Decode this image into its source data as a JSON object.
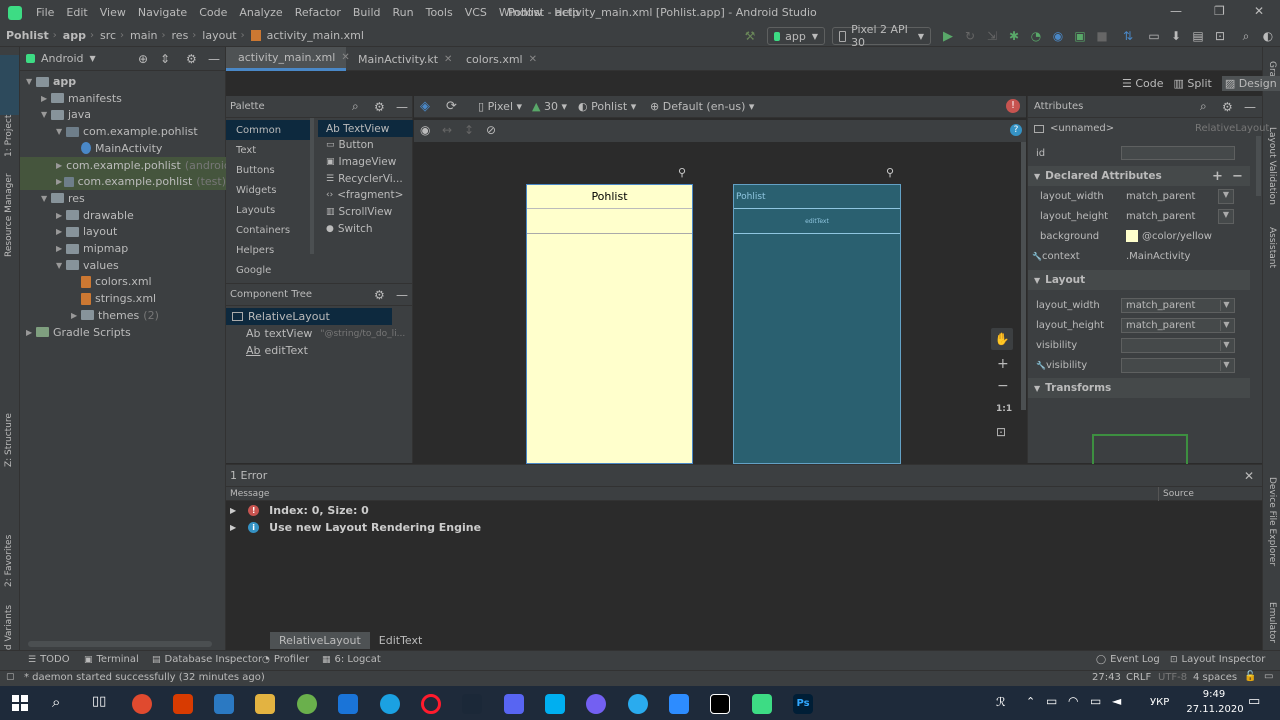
{
  "app": {
    "window_title": "Pohlist - activity_main.xml [Pohlist.app] - Android Studio"
  },
  "menu": [
    "File",
    "Edit",
    "View",
    "Navigate",
    "Code",
    "Analyze",
    "Refactor",
    "Build",
    "Run",
    "Tools",
    "VCS",
    "Window",
    "Help"
  ],
  "breadcrumbs": [
    "Pohlist",
    "app",
    "src",
    "main",
    "res",
    "layout",
    "activity_main.xml"
  ],
  "toolbar": {
    "run_config": "app",
    "device": "Pixel 2 API 30"
  },
  "left_strip": {
    "project": "1: Project",
    "resource_manager": "Resource Manager",
    "structure": "Z: Structure",
    "favorites": "2: Favorites",
    "build_variants": "Build Variants"
  },
  "right_strip": {
    "gradle": "Gradle",
    "layout_validation": "Layout Validation",
    "assistant": "Assistant",
    "device_file_explorer": "Device File Explorer",
    "emulator": "Emulator"
  },
  "project": {
    "view": "Android",
    "tree": [
      {
        "label": "app",
        "indent": 0,
        "type": "folder",
        "open": true,
        "bold": true
      },
      {
        "label": "manifests",
        "indent": 1,
        "type": "folder"
      },
      {
        "label": "java",
        "indent": 1,
        "type": "folder",
        "open": true
      },
      {
        "label": "com.example.pohlist",
        "indent": 2,
        "type": "package",
        "open": true
      },
      {
        "label": "MainActivity",
        "indent": 3,
        "type": "kotlin"
      },
      {
        "label": "com.example.pohlist",
        "suffix": "(androidTe",
        "indent": 2,
        "type": "package",
        "highlight": true
      },
      {
        "label": "com.example.pohlist",
        "suffix": "(test)",
        "indent": 2,
        "type": "package",
        "highlight": true
      },
      {
        "label": "res",
        "indent": 1,
        "type": "folder",
        "open": true
      },
      {
        "label": "drawable",
        "indent": 2,
        "type": "folder"
      },
      {
        "label": "layout",
        "indent": 2,
        "type": "folder"
      },
      {
        "label": "mipmap",
        "indent": 2,
        "type": "folder"
      },
      {
        "label": "values",
        "indent": 2,
        "type": "folder",
        "open": true
      },
      {
        "label": "colors.xml",
        "indent": 3,
        "type": "xml"
      },
      {
        "label": "strings.xml",
        "indent": 3,
        "type": "xml"
      },
      {
        "label": "themes",
        "suffix": "(2)",
        "indent": 3,
        "type": "folder"
      },
      {
        "label": "Gradle Scripts",
        "indent": 0,
        "type": "gradle"
      }
    ]
  },
  "tabs": [
    {
      "label": "activity_main.xml",
      "active": true
    },
    {
      "label": "MainActivity.kt"
    },
    {
      "label": "colors.xml"
    }
  ],
  "editor_modes": {
    "code": "Code",
    "split": "Split",
    "design": "Design"
  },
  "palette": {
    "title": "Palette",
    "categories": [
      "Common",
      "Text",
      "Buttons",
      "Widgets",
      "Layouts",
      "Containers",
      "Helpers",
      "Google"
    ],
    "items": [
      "Ab TextView",
      "Button",
      "ImageView",
      "RecyclerVi...",
      "<fragment>",
      "ScrollView",
      "Switch"
    ]
  },
  "component_tree": {
    "title": "Component Tree",
    "root": "RelativeLayout",
    "children": [
      {
        "label": "textView",
        "hint": "\"@string/to_do_li..."
      },
      {
        "label": "editText",
        "hint": ""
      }
    ]
  },
  "design_toolbar": {
    "device": "Pixel",
    "api": "30",
    "theme": "Pohlist",
    "locale": "Default (en-us)"
  },
  "preview": {
    "title": "Pohlist",
    "blueprint_title": "Pohlist",
    "blueprint_edit": "editText",
    "bg_color": "#ffffcc",
    "blueprint_color": "#2a6070"
  },
  "zoom": {
    "ratio": "1:1"
  },
  "attributes": {
    "title": "Attributes",
    "unnamed": "<unnamed>",
    "type": "RelativeLayout",
    "id_label": "id",
    "declared_title": "Declared Attributes",
    "declared": [
      {
        "name": "layout_width",
        "value": "match_parent"
      },
      {
        "name": "layout_height",
        "value": "match_parent"
      },
      {
        "name": "background",
        "value": "@color/yellow"
      },
      {
        "name": "context",
        "value": ".MainActivity"
      }
    ],
    "layout_title": "Layout",
    "layout": [
      {
        "name": "layout_width",
        "value": "match_parent"
      },
      {
        "name": "layout_height",
        "value": "match_parent"
      },
      {
        "name": "visibility",
        "value": ""
      },
      {
        "name": "visibility",
        "value": ""
      }
    ],
    "transforms_title": "Transforms"
  },
  "problems": {
    "title": "1 Error",
    "col_message": "Message",
    "col_source": "Source",
    "items": [
      {
        "text": "Index: 0, Size: 0",
        "level": "error"
      },
      {
        "text": "Use new Layout Rendering Engine",
        "level": "info"
      }
    ]
  },
  "design_breadcrumb": [
    "RelativeLayout",
    "EditText"
  ],
  "bottom_tools": [
    "TODO",
    "Terminal",
    "Database Inspector",
    "Profiler",
    "6: Logcat",
    "Event Log",
    "Layout Inspector"
  ],
  "status": {
    "message": "* daemon started successfully (32 minutes ago)",
    "position": "27:43",
    "line_sep": "CRLF",
    "encoding": "UTF-8",
    "indent": "4 spaces"
  },
  "taskbar": {
    "lang": "УКР",
    "time": "9:49",
    "date": "27.11.2020"
  },
  "colors": {
    "accent": "#4a88c7",
    "error": "#c75450",
    "info": "#3592c4",
    "yellow": "#ffffcc"
  }
}
